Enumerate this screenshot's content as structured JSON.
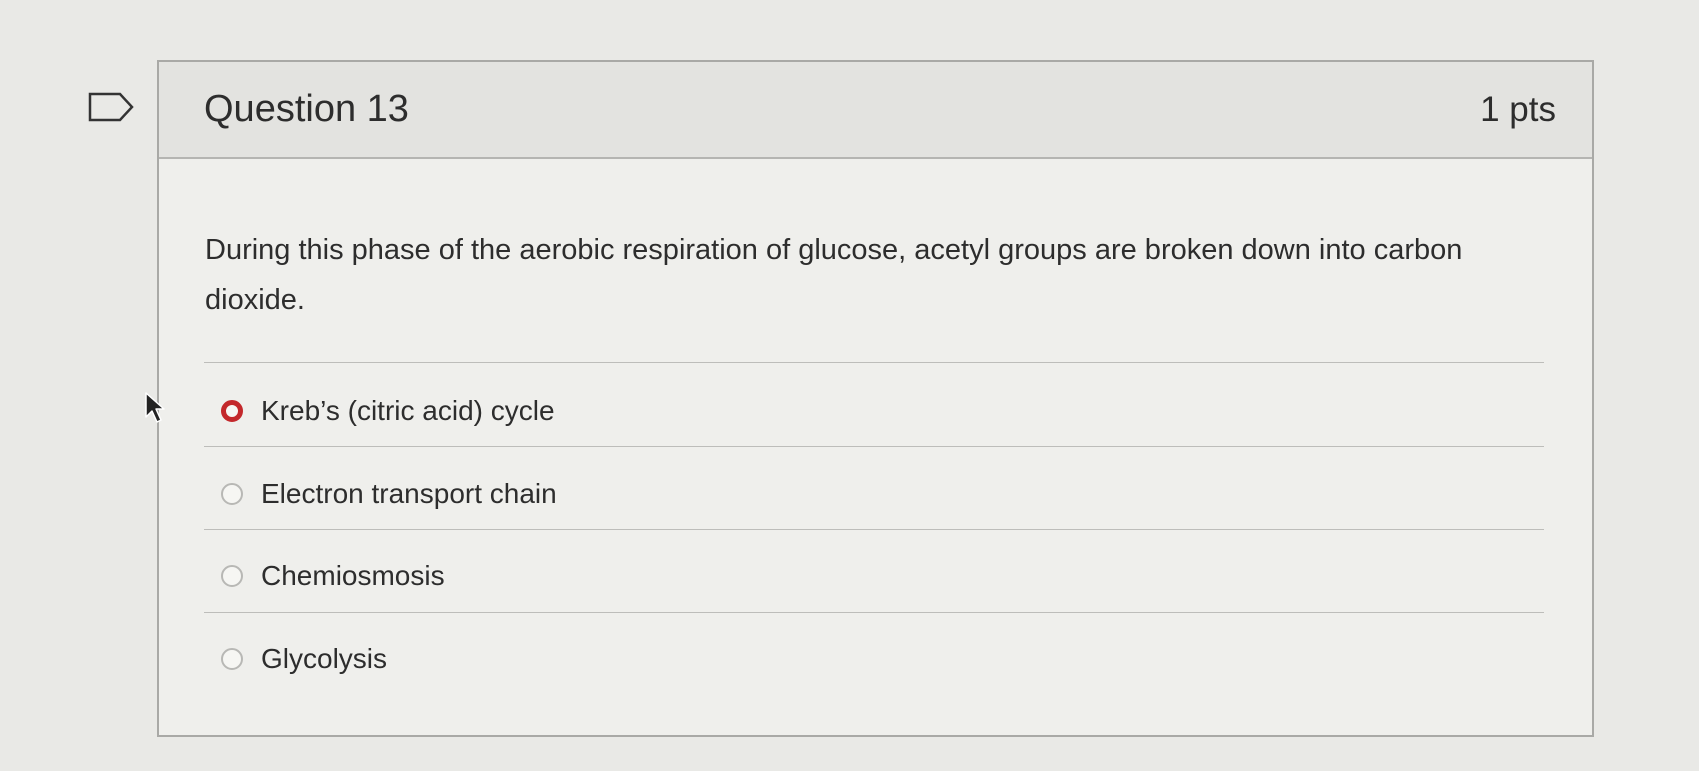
{
  "question": {
    "title": "Question 13",
    "points": "1 pts",
    "text": "During this phase of the aerobic respiration of glucose, acetyl groups are broken down into carbon dioxide."
  },
  "answers": [
    {
      "label": "Kreb’s (citric acid) cycle",
      "selected": true
    },
    {
      "label": "Electron transport chain",
      "selected": false
    },
    {
      "label": "Chemiosmosis",
      "selected": false
    },
    {
      "label": "Glycolysis",
      "selected": false
    }
  ],
  "icons": {
    "bookmark": "bookmark-flag-icon",
    "cursor": "mouse-pointer-icon"
  },
  "colors": {
    "selected_radio": "#c3282b"
  }
}
